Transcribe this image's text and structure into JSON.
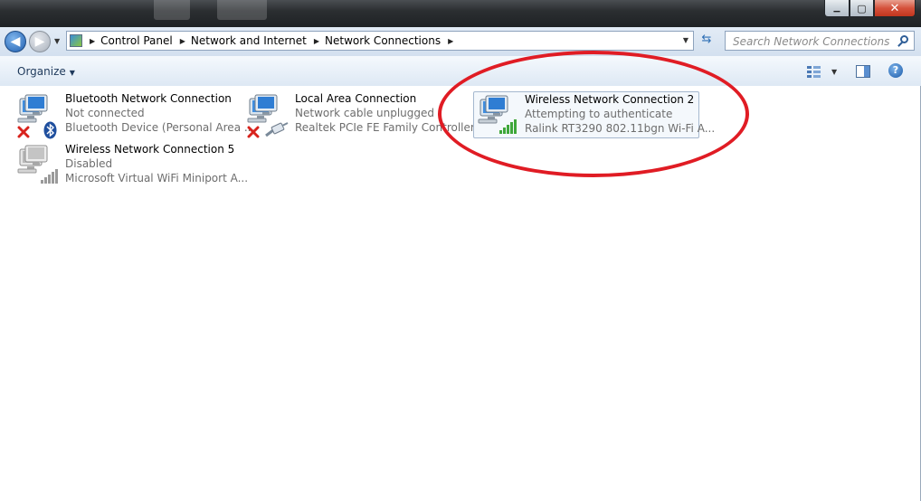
{
  "window": {
    "minimize_glyph": "▁",
    "maximize_glyph": "▢",
    "close_glyph": "✕"
  },
  "breadcrumb": [
    "Control Panel",
    "Network and Internet",
    "Network Connections"
  ],
  "search": {
    "placeholder": "Search Network Connections"
  },
  "toolbar": {
    "organize_label": "Organize"
  },
  "help_label": "?",
  "connections": [
    {
      "name": "Bluetooth Network Connection",
      "status": "Not connected",
      "device": "Bluetooth Device (Personal Area ...",
      "badge": "red-x-icon",
      "extra": "bluetooth-icon"
    },
    {
      "name": "Local Area Connection",
      "status": "Network cable unplugged",
      "device": "Realtek PCIe FE Family Controller",
      "badge": "red-x-icon",
      "extra": "ethernet-cable-icon"
    },
    {
      "name": "Wireless Network Connection 2",
      "status": "Attempting to authenticate",
      "device": "Ralink RT3290 802.11bgn Wi-Fi A...",
      "badge": "",
      "extra": "signal-bars-green-icon"
    },
    {
      "name": "Wireless Network Connection 5",
      "status": "Disabled",
      "device": "Microsoft Virtual WiFi Miniport A...",
      "badge": "",
      "extra": "signal-bars-gray-icon"
    }
  ],
  "colors": {
    "annotation_red": "#e01c24",
    "accent_blue": "#1f5fb0"
  }
}
